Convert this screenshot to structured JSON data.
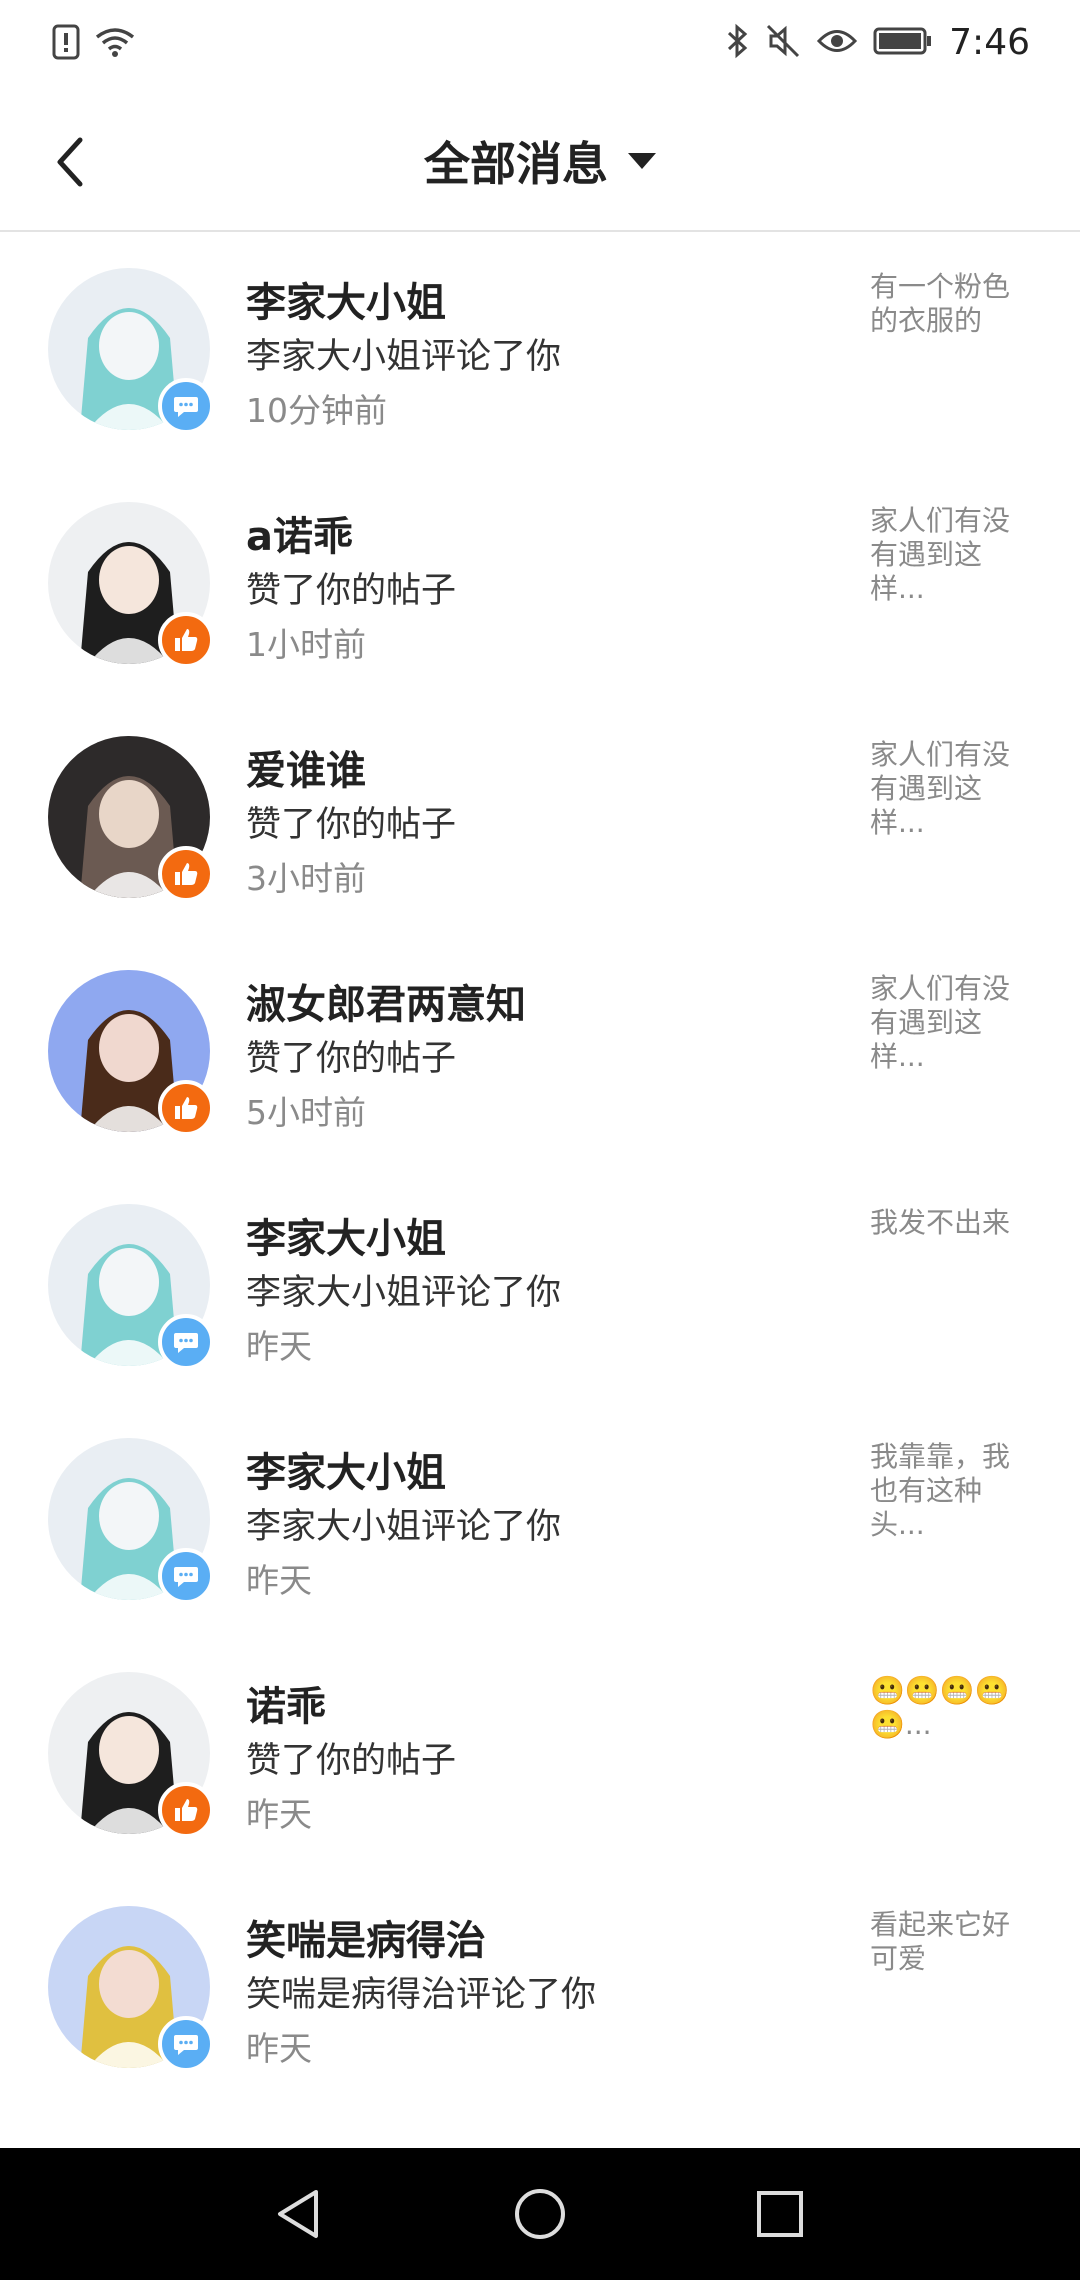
{
  "status_bar": {
    "time": "7:46",
    "icons": [
      "sim-alert-icon",
      "wifi-icon",
      "bluetooth-icon",
      "mute-icon",
      "eye-icon",
      "battery-icon"
    ]
  },
  "header": {
    "title": "全部消息",
    "back_icon": "chevron-left-icon",
    "dropdown_icon": "caret-down-icon"
  },
  "messages": [
    {
      "name": "李家大小姐",
      "action": "李家大小姐评论了你",
      "time": "10分钟前",
      "preview": "有一个粉色的衣服的",
      "badge": "comment"
    },
    {
      "name": "a诺乖",
      "action": "赞了你的帖子",
      "time": "1小时前",
      "preview": "家人们有没有遇到这样...",
      "badge": "like"
    },
    {
      "name": "爱谁谁",
      "action": "赞了你的帖子",
      "time": "3小时前",
      "preview": "家人们有没有遇到这样...",
      "badge": "like"
    },
    {
      "name": "淑女郎君两意知",
      "action": "赞了你的帖子",
      "time": "5小时前",
      "preview": "家人们有没有遇到这样...",
      "badge": "like"
    },
    {
      "name": "李家大小姐",
      "action": "李家大小姐评论了你",
      "time": "昨天",
      "preview": "我发不出来",
      "badge": "comment"
    },
    {
      "name": "李家大小姐",
      "action": "李家大小姐评论了你",
      "time": "昨天",
      "preview": "我靠靠，我也有这种头...",
      "badge": "comment"
    },
    {
      "name": "诺乖",
      "action": "赞了你的帖子",
      "time": "昨天",
      "preview": "😬😬😬😬😬...",
      "badge": "like"
    },
    {
      "name": "笑喘是病得治",
      "action": "笑喘是病得治评论了你",
      "time": "昨天",
      "preview": "看起来它好可爱",
      "badge": "comment"
    }
  ],
  "nav_bar": {
    "back_icon": "triangle-back-icon",
    "home_icon": "circle-home-icon",
    "recents_icon": "square-recents-icon"
  },
  "colors": {
    "comment_badge": "#5aaef4",
    "like_badge": "#f36a10",
    "secondary_text": "#8a8a8a"
  }
}
